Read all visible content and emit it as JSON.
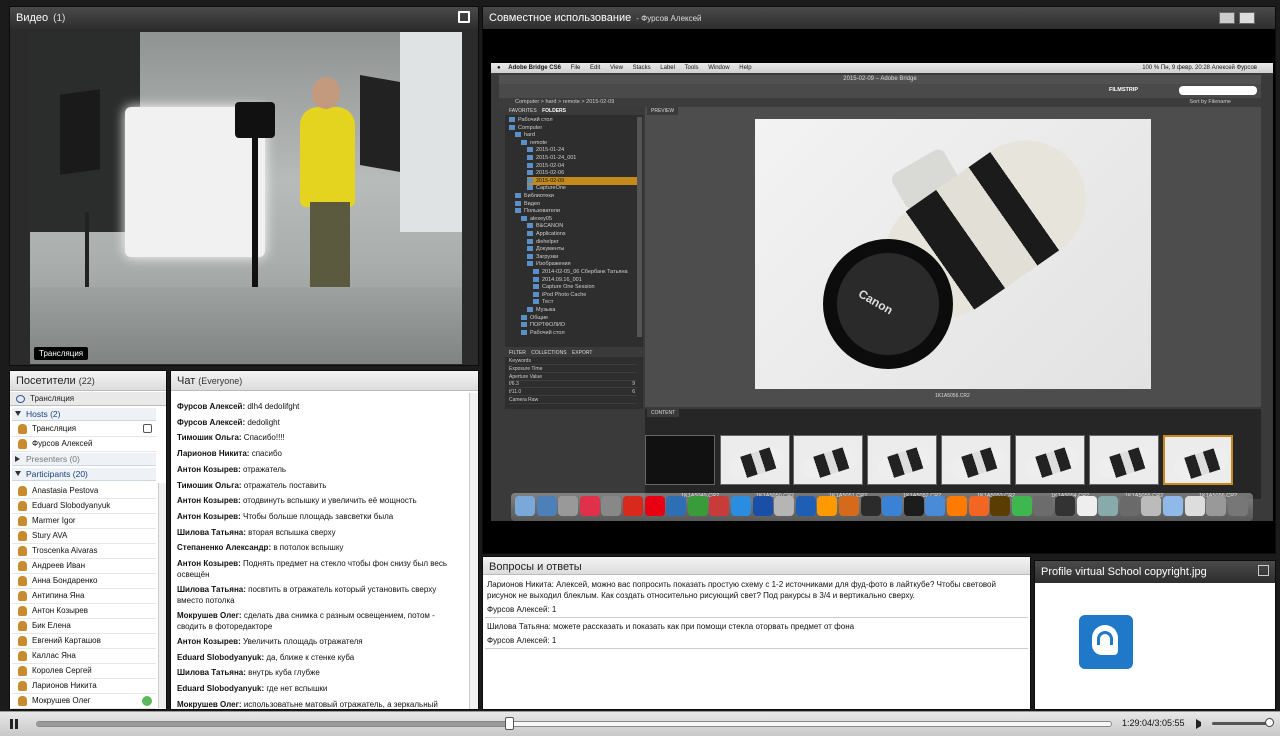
{
  "video": {
    "title": "Видео",
    "count": "(1)",
    "caption": "Трансляция"
  },
  "share": {
    "title": "Совместное использование",
    "presenter": "- Фурсов Алексей"
  },
  "mac": {
    "menus": [
      "Adobe Bridge CS6",
      "File",
      "Edit",
      "View",
      "Stacks",
      "Label",
      "Tools",
      "Window",
      "Help"
    ],
    "status": "100 %  Пн, 9 февр.  20:28   Алексей Фурсов",
    "window_title": "2015-02-09 – Adobe Bridge",
    "filmstrip": "FILMSTRIP",
    "sort": "Sort by Filename",
    "path": [
      "Computer",
      "hard",
      "remote",
      "2015-02-09"
    ],
    "tabs": {
      "favorites": "FAVORITES",
      "folders": "FOLDERS",
      "preview": "PREVIEW",
      "filter": "FILTER",
      "collections": "COLLECTIONS",
      "export": "EXPORT",
      "content": "CONTENT"
    },
    "folders": [
      "Рабочий стол",
      "Computer",
      "hard",
      "remote",
      "2015-01-24",
      "2015-01-24_001",
      "2015-02-04",
      "2015-02-06",
      "2015-02-09",
      "CaptureOne",
      "Библиотеки",
      "Видео",
      "Пользователи",
      "alexey05",
      "B&CANON",
      "Applications",
      "diehelper",
      "Документы",
      "Загрузки",
      "Изображения",
      "2014-02-05_06 Сбербанк Татьяна",
      "2014.09.16_001",
      "Capture One Session",
      "iPod Photo Cache",
      "Тест",
      "Музыка",
      "Общие",
      "ПОРТФОЛИО",
      "Рабочий стол"
    ],
    "filters": [
      {
        "label": "Keywords",
        "value": ""
      },
      {
        "label": "Exposure Time",
        "value": ""
      },
      {
        "label": "Aperture Value",
        "value": ""
      },
      {
        "label": "f/6.3",
        "value": "9"
      },
      {
        "label": "f/11.0",
        "value": "6"
      },
      {
        "label": "Camera Raw",
        "value": ""
      }
    ],
    "preview_label": "1K1A5056.CR2",
    "lens_brand": "Canon",
    "thumbs": [
      "1K1A5049.CR2",
      "1K1A5050.CR2",
      "1K1A5051.CR2",
      "1K1A5052.CR2",
      "1K1A5053.CR2",
      "1K1A5054.CR2",
      "1K1A5055.CR2",
      "1K1A5056.CR2"
    ]
  },
  "attendees": {
    "title": "Посетители",
    "count": "(22)",
    "broadcast": "Трансляция",
    "hosts_label": "Hosts (2)",
    "hosts": [
      "Трансляция",
      "Фурсов Алексей"
    ],
    "presenters_label": "Presenters (0)",
    "participants_label": "Participants (20)",
    "participants": [
      "Anastasia Pestova",
      "Eduard Slobodyanyuk",
      "Marmer Igor",
      "Stury AVA",
      "Troscenka Aivaras",
      "Андреев Иван",
      "Анна Бондаренко",
      "Антипина Яна",
      "Антон Козырев",
      "Бик Елена",
      "Евгений Карташов",
      "Каллас Яна",
      "Королев Сергей",
      "Ларионов Никита",
      "Мокрушев Олег"
    ]
  },
  "chat": {
    "title": "Чат",
    "scope": "(Everyone)",
    "messages": [
      {
        "author": "Фурсов Алексей:",
        "text": "dlh4 dedolifght"
      },
      {
        "author": "Фурсов Алексей:",
        "text": "dedolight"
      },
      {
        "author": "Тимошик Ольга:",
        "text": "Спасибо!!!!"
      },
      {
        "author": "Ларионов Никита:",
        "text": "спасибо"
      },
      {
        "author": "Антон Козырев:",
        "text": "отражатель"
      },
      {
        "author": "Тимошик Ольга:",
        "text": "отражатель поставить"
      },
      {
        "author": "Антон Козырев:",
        "text": "отодвинуть вспышку и увеличить её мощность"
      },
      {
        "author": "Антон Козырев:",
        "text": "Чтобы больше площадь завсветки была"
      },
      {
        "author": "Шилова Татьяна:",
        "text": "вторая вспышка сверху"
      },
      {
        "author": "Степаненко Александр:",
        "text": "в потолок вспышку"
      },
      {
        "author": "Антон Козырев:",
        "text": "Поднять предмет на стекло чтобы фон снизу был весь освещён"
      },
      {
        "author": "Шилова Татьяна:",
        "text": "посвтить в отражатель который установить сверху вместо потолка"
      },
      {
        "author": "Мокрушев Олег:",
        "text": "сделать два снимка с разным освещением, потом - сводить в фоторедакторе"
      },
      {
        "author": "Антон Козырев:",
        "text": "Увеличить площадь отражателя"
      },
      {
        "author": "Eduard Slobodyanyuk:",
        "text": "да, ближе к стенке куба"
      },
      {
        "author": "Шилова Татьяна:",
        "text": "внутрь куба глубже"
      },
      {
        "author": "Eduard Slobodyanyuk:",
        "text": "где нет вспышки"
      },
      {
        "author": "Мокрушев Олег:",
        "text": "использоватьне матовый отражатель, а зеркальный"
      }
    ]
  },
  "qa": {
    "title": "Вопросы и ответы",
    "items": [
      {
        "question": "Ларионов Никита: Алексей, можно вас попросить показать простую схему с 1-2 источниками для фуд-фото в лайткубе? Чтобы световой рисунок не выходил блеклым. Как создать относительно рисующий свет? Под ракурсы в 3/4 и вертикально сверху.",
        "answer": "Фурсов Алексей: 1"
      },
      {
        "question": "Шилова Татьяна: можете рассказать и показать как при помощи стекла оторвать предмет от фона",
        "answer": "Фурсов Алексей: 1"
      }
    ]
  },
  "profile": {
    "title": "Profile virtual School copyright.jpg"
  },
  "player": {
    "time": "1:29:04/3:05:55",
    "progress": 0.44
  },
  "colors": {
    "accent": "#1f78c8",
    "highlight": "#c58a1c"
  }
}
